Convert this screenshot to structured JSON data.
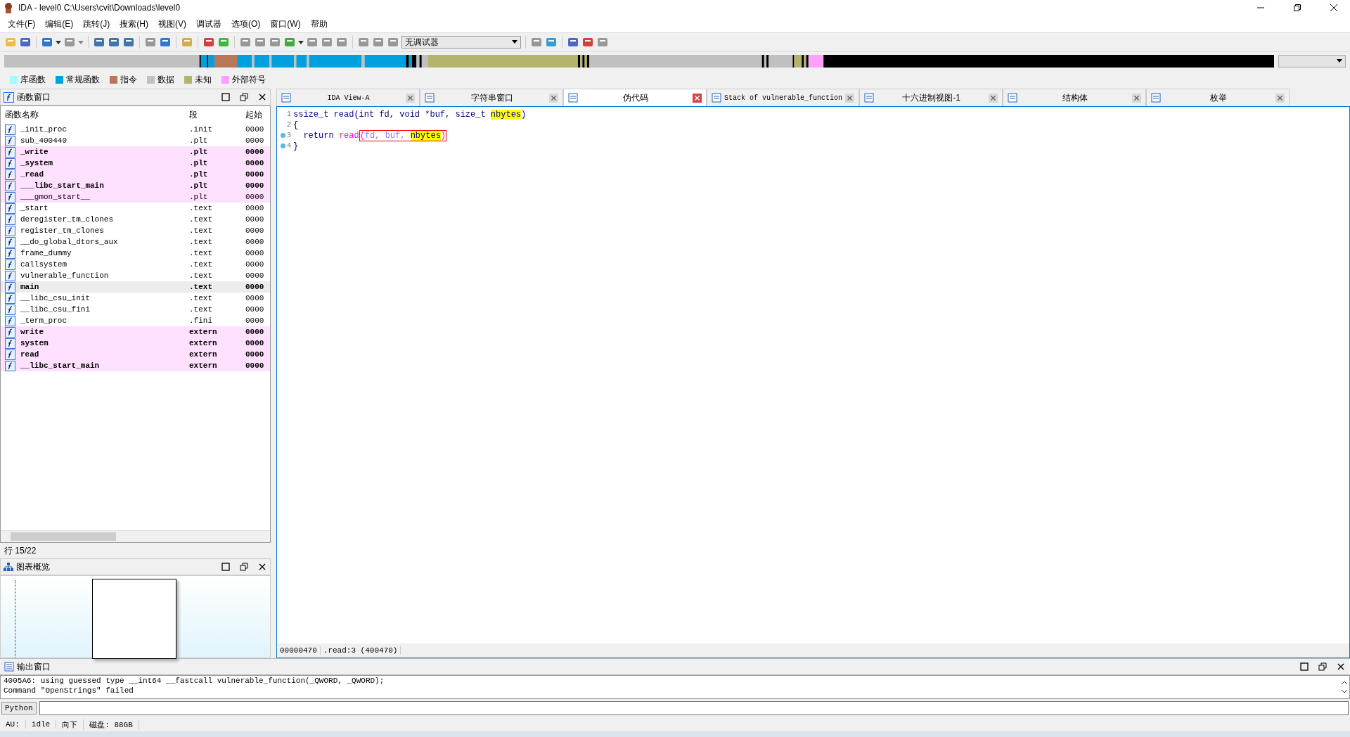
{
  "window": {
    "title": "IDA - level0 C:\\Users\\cvit\\Downloads\\level0"
  },
  "menu": [
    "文件(F)",
    "编辑(E)",
    "跳转(J)",
    "搜索(H)",
    "视图(V)",
    "调试器",
    "选项(O)",
    "窗口(W)",
    "帮助"
  ],
  "toolbar": {
    "debugger_select": "无调试器"
  },
  "legend": [
    {
      "label": "库函数",
      "color": "#a0ffff"
    },
    {
      "label": "常规函数",
      "color": "#00a0e0"
    },
    {
      "label": "指令",
      "color": "#b87858"
    },
    {
      "label": "数据",
      "color": "#c0c0c0"
    },
    {
      "label": "未知",
      "color": "#b4b46c"
    },
    {
      "label": "外部符号",
      "color": "#ffa0ff"
    }
  ],
  "functions_window": {
    "title": "函数窗口",
    "columns": [
      "函数名称",
      "段",
      "起始"
    ],
    "rows": [
      {
        "name": "_init_proc",
        "segment": ".init",
        "start": "0000",
        "kind": "regular",
        "bold": false,
        "selected": false
      },
      {
        "name": "sub_400440",
        "segment": ".plt",
        "start": "0000",
        "kind": "regular",
        "bold": false,
        "selected": false
      },
      {
        "name": "_write",
        "segment": ".plt",
        "start": "0000",
        "kind": "import",
        "bold": true,
        "selected": false
      },
      {
        "name": "_system",
        "segment": ".plt",
        "start": "0000",
        "kind": "import",
        "bold": true,
        "selected": false
      },
      {
        "name": "_read",
        "segment": ".plt",
        "start": "0000",
        "kind": "import",
        "bold": true,
        "selected": false
      },
      {
        "name": "___libc_start_main",
        "segment": ".plt",
        "start": "0000",
        "kind": "import",
        "bold": true,
        "selected": false
      },
      {
        "name": "___gmon_start__",
        "segment": ".plt",
        "start": "0000",
        "kind": "import",
        "bold": false,
        "selected": false
      },
      {
        "name": "_start",
        "segment": ".text",
        "start": "0000",
        "kind": "regular",
        "bold": false,
        "selected": false
      },
      {
        "name": "deregister_tm_clones",
        "segment": ".text",
        "start": "0000",
        "kind": "regular",
        "bold": false,
        "selected": false
      },
      {
        "name": "register_tm_clones",
        "segment": ".text",
        "start": "0000",
        "kind": "regular",
        "bold": false,
        "selected": false
      },
      {
        "name": "__do_global_dtors_aux",
        "segment": ".text",
        "start": "0000",
        "kind": "regular",
        "bold": false,
        "selected": false
      },
      {
        "name": "frame_dummy",
        "segment": ".text",
        "start": "0000",
        "kind": "regular",
        "bold": false,
        "selected": false
      },
      {
        "name": "callsystem",
        "segment": ".text",
        "start": "0000",
        "kind": "regular",
        "bold": false,
        "selected": false
      },
      {
        "name": "vulnerable_function",
        "segment": ".text",
        "start": "0000",
        "kind": "regular",
        "bold": false,
        "selected": false
      },
      {
        "name": "main",
        "segment": ".text",
        "start": "0000",
        "kind": "regular",
        "bold": true,
        "selected": true
      },
      {
        "name": "__libc_csu_init",
        "segment": ".text",
        "start": "0000",
        "kind": "regular",
        "bold": false,
        "selected": false
      },
      {
        "name": "__libc_csu_fini",
        "segment": ".text",
        "start": "0000",
        "kind": "regular",
        "bold": false,
        "selected": false
      },
      {
        "name": "_term_proc",
        "segment": ".fini",
        "start": "0000",
        "kind": "regular",
        "bold": false,
        "selected": false
      },
      {
        "name": "write",
        "segment": "extern",
        "start": "0000",
        "kind": "import",
        "bold": true,
        "selected": false
      },
      {
        "name": "system",
        "segment": "extern",
        "start": "0000",
        "kind": "import",
        "bold": true,
        "selected": false
      },
      {
        "name": "read",
        "segment": "extern",
        "start": "0000",
        "kind": "import",
        "bold": true,
        "selected": false
      },
      {
        "name": "__libc_start_main",
        "segment": "extern",
        "start": "0000",
        "kind": "import",
        "bold": true,
        "selected": false
      }
    ],
    "row_counter": "行 15/22"
  },
  "graph_overview": {
    "title": "图表概览"
  },
  "tabs": [
    {
      "label": "IDA View-A",
      "selected": false
    },
    {
      "label": "字符串窗口",
      "selected": false
    },
    {
      "label": "伪代码",
      "selected": true
    },
    {
      "label": "Stack of vulnerable_function",
      "selected": false
    },
    {
      "label": "十六进制视图-1",
      "selected": false
    },
    {
      "label": "结构体",
      "selected": false
    },
    {
      "label": "枚举",
      "selected": false
    }
  ],
  "code": {
    "lines": [
      {
        "number": "1",
        "breakpoint": false,
        "tokens": [
          {
            "text": "ssize_t read(int fd, void *buf, size_t ",
            "kind": "plain"
          },
          {
            "text": "nbytes",
            "kind": "match"
          },
          {
            "text": ")",
            "kind": "plain"
          }
        ]
      },
      {
        "number": "2",
        "breakpoint": false,
        "tokens": [
          {
            "text": "{",
            "kind": "plain"
          }
        ]
      },
      {
        "number": "3",
        "breakpoint": true,
        "tokens": [
          {
            "text": "  return ",
            "kind": "plain"
          },
          {
            "text": "read",
            "kind": "call"
          },
          {
            "kind": "boxed",
            "tokens": [
              {
                "text": "(",
                "kind": "call"
              },
              {
                "text": "fd, buf, ",
                "kind": "arg"
              },
              {
                "text": "nbytes",
                "kind": "match"
              },
              {
                "text": ")",
                "kind": "call"
              }
            ]
          }
        ]
      },
      {
        "number": "4",
        "breakpoint": true,
        "tokens": [
          {
            "text": "}",
            "kind": "plain"
          }
        ]
      }
    ],
    "status": [
      "00000470",
      ".read:3 (400470)"
    ]
  },
  "output_window": {
    "title": "输出窗口",
    "lines": [
      "4005A6: using guessed type __int64 __fastcall vulnerable_function(_QWORD, _QWORD);",
      "Command \"OpenStrings\" failed"
    ],
    "language": "Python"
  },
  "status_bar": [
    "AU:",
    "idle",
    "向下",
    "磁盘: 88GB"
  ]
}
